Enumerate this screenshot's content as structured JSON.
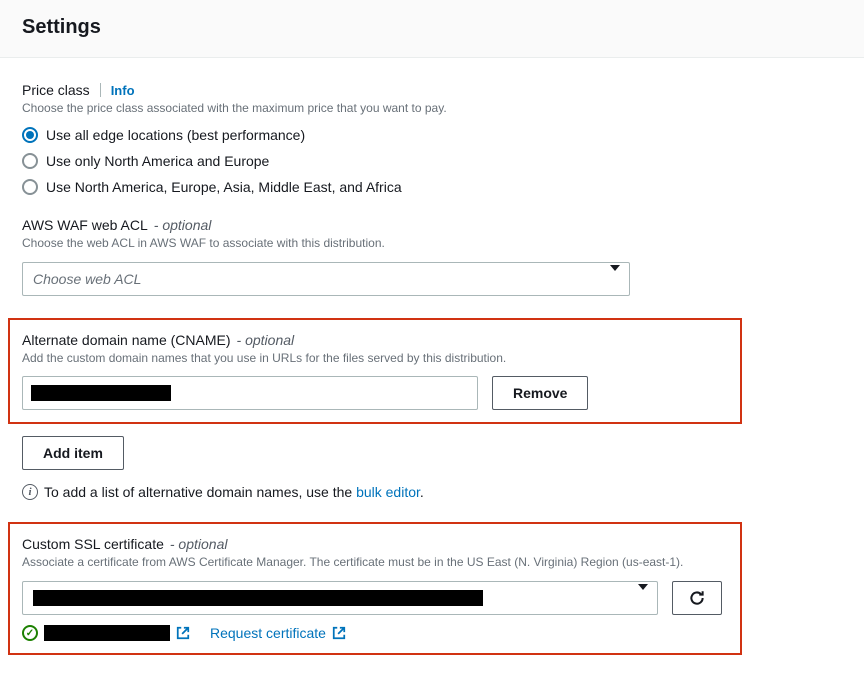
{
  "page_title": "Settings",
  "price_class": {
    "label": "Price class",
    "info": "Info",
    "description": "Choose the price class associated with the maximum price that you want to pay.",
    "options": [
      "Use all edge locations (best performance)",
      "Use only North America and Europe",
      "Use North America, Europe, Asia, Middle East, and Africa"
    ],
    "selected_index": 0
  },
  "waf": {
    "label": "AWS WAF web ACL",
    "optional": "- optional",
    "description": "Choose the web ACL in AWS WAF to associate with this distribution.",
    "placeholder": "Choose web ACL"
  },
  "cname": {
    "label": "Alternate domain name (CNAME)",
    "optional": "- optional",
    "description": "Add the custom domain names that you use in URLs for the files served by this distribution.",
    "value_redacted": true,
    "remove_label": "Remove",
    "add_item_label": "Add item",
    "bulk_text_prefix": "To add a list of alternative domain names, use the ",
    "bulk_link": "bulk editor",
    "bulk_text_suffix": "."
  },
  "ssl": {
    "label": "Custom SSL certificate",
    "optional": "- optional",
    "description": "Associate a certificate from AWS Certificate Manager. The certificate must be in the US East (N. Virginia) Region (us-east-1).",
    "selected_redacted": true,
    "status_redacted": true,
    "request_link": "Request certificate"
  }
}
